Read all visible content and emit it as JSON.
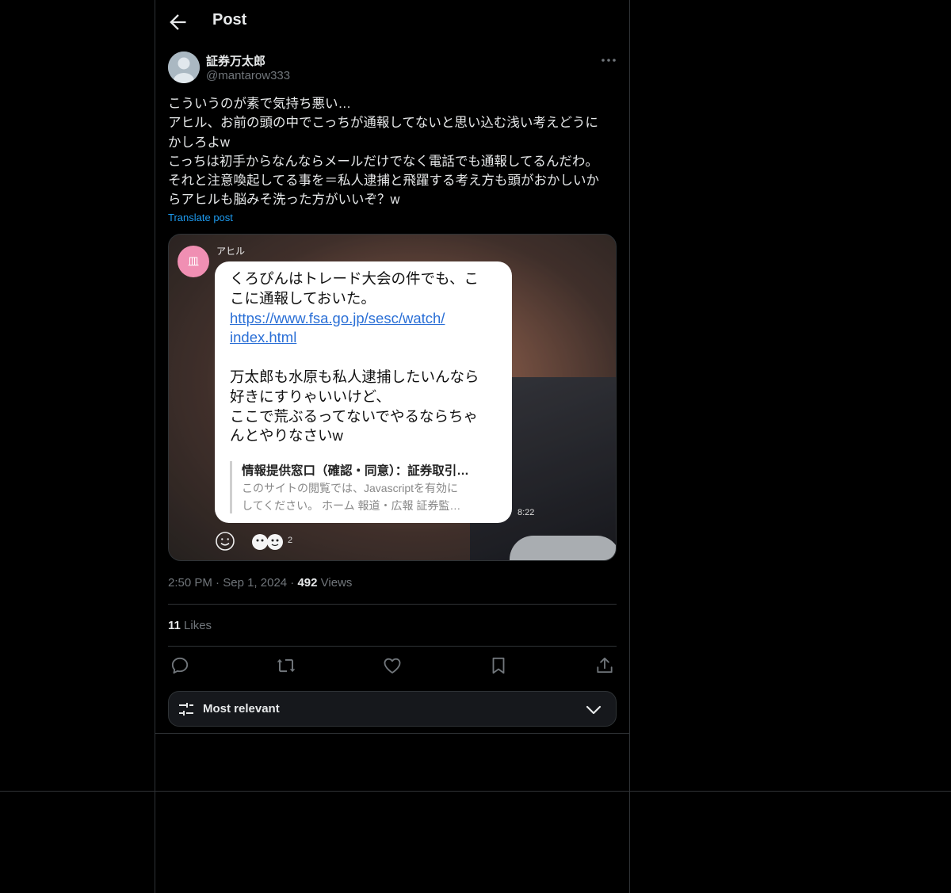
{
  "header": {
    "title": "Post"
  },
  "post": {
    "author_name": "証券万太郎",
    "author_handle": "@mantarow333",
    "text_lines": [
      "こういうのが素で気持ち悪い…",
      "アヒル、お前の頭の中でこっちが通報してないと思い込む浅い考えどうに",
      "かしろよw",
      "こっちは初手からなんならメールだけでなく電話でも通報してるんだわ。",
      "それと注意喚起してる事を＝私人逮捕と飛躍する考え方も頭がおかしいか",
      "らアヒルも脳みそ洗った方がいいぞ？w"
    ],
    "translate_label": "Translate post",
    "time": "2:50 PM",
    "date": "Sep 1, 2024",
    "views_count": "492",
    "views_label": "Views",
    "likes_count": "11",
    "likes_label": "Likes"
  },
  "media": {
    "chat_avatar_text": "皿",
    "chat_sender": "アヒル",
    "bubble_lines": [
      "くろぴんはトレード大会の件でも、こ",
      "こに通報しておいた。"
    ],
    "link_lines": [
      "https://www.fsa.go.jp/sesc/watch/",
      "index.html"
    ],
    "bubble_lines_2": [
      "万太郎も水原も私人逮捕したいんなら",
      "好きにすりゃいいけど、",
      "ここで荒ぶるってないでやるならちゃ",
      "んとやりなさいw"
    ],
    "preview_title": "情報提供窓口（確認・同意）：証券取引…",
    "preview_desc_1": "このサイトの閲覧では、Javascriptを有効に",
    "preview_desc_2": "してください。 ホーム 報道・広報 証券監…",
    "chat_time": "8:22",
    "reaction_count": "2"
  },
  "sort": {
    "label": "Most relevant"
  },
  "icons": {
    "back": "arrow-left-icon",
    "more": "more-dots-icon",
    "reply": "reply-icon",
    "repost": "repost-icon",
    "like": "heart-icon",
    "bookmark": "bookmark-icon",
    "share": "share-icon",
    "sort": "sliders-icon",
    "chevron": "chevron-down-icon"
  },
  "colors": {
    "background": "#000000",
    "accent": "#1d9bf0",
    "muted": "#71767b",
    "border": "#2f3336"
  }
}
